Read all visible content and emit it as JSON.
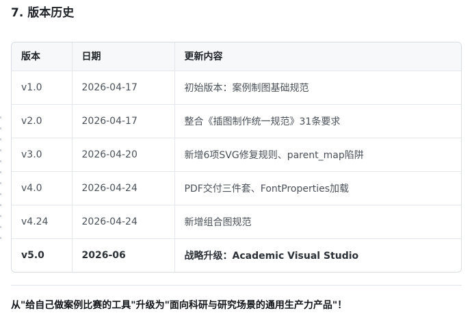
{
  "section": {
    "heading": "7. 版本历史"
  },
  "table": {
    "headers": [
      "版本",
      "日期",
      "更新内容"
    ],
    "rows": [
      {
        "version": "v1.0",
        "date": "2026-04-17",
        "content": "初始版本：案例制图基础规范",
        "bold": false
      },
      {
        "version": "v2.0",
        "date": "2026-04-17",
        "content": "整合《插图制作统一规范》31条要求",
        "bold": false
      },
      {
        "version": "v3.0",
        "date": "2026-04-20",
        "content": "新增6项SVG修复规则、parent_map陷阱",
        "bold": false
      },
      {
        "version": "v4.0",
        "date": "2026-04-24",
        "content": "PDF交付三件套、FontProperties加载",
        "bold": false
      },
      {
        "version": "v4.24",
        "date": "2026-04-24",
        "content": "新增组合图规范",
        "bold": false
      },
      {
        "version": "v5.0",
        "date": "2026-06",
        "content": "战略升级：Academic Visual Studio",
        "bold": true
      }
    ]
  },
  "conclusion": {
    "text": "从\"给自己做案例比赛的工具\"升级为\"面向科研与研究场景的通用生产力产品\"！"
  }
}
